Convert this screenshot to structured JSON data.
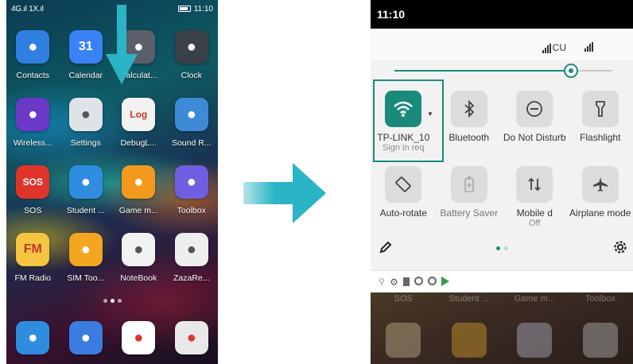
{
  "home": {
    "status": {
      "left": "4G.ıl 1X.ıl",
      "time": "11:10"
    },
    "rows": [
      [
        {
          "label": "Contacts",
          "icon": "contacts-icon",
          "color": "#2f7fe0"
        },
        {
          "label": "Calendar",
          "icon": "calendar-icon",
          "color": "#3b82f6",
          "glyph": "31"
        },
        {
          "label": "Calculat...",
          "icon": "calculator-icon",
          "color": "#5a5f6a"
        },
        {
          "label": "Clock",
          "icon": "clock-icon",
          "color": "#3a3f48"
        }
      ],
      [
        {
          "label": "Wireless...",
          "icon": "shield-icon",
          "color": "#6a39c8"
        },
        {
          "label": "Settings",
          "icon": "gear-icon",
          "color": "#dfe3e8"
        },
        {
          "label": "DebugL...",
          "icon": "log-icon",
          "color": "#f2f2f2",
          "glyph": "Log"
        },
        {
          "label": "Sound R...",
          "icon": "sound-recorder-icon",
          "color": "#3d8bd6"
        }
      ],
      [
        {
          "label": "SOS",
          "icon": "sos-icon",
          "color": "#e0342b",
          "glyph": "SOS"
        },
        {
          "label": "Student ...",
          "icon": "student-icon",
          "color": "#2f8de0"
        },
        {
          "label": "Game m...",
          "icon": "gamepad-icon",
          "color": "#f39a1e"
        },
        {
          "label": "Toolbox",
          "icon": "toolbox-icon",
          "color": "#6f5ee0"
        }
      ],
      [
        {
          "label": "FM Radio",
          "icon": "radio-icon",
          "color": "#f5c542",
          "glyph": "FM"
        },
        {
          "label": "SIM Too...",
          "icon": "sim-icon",
          "color": "#f4a623"
        },
        {
          "label": "NoteBook",
          "icon": "notebook-icon",
          "color": "#f2f2f2"
        },
        {
          "label": "ZazaRe...",
          "icon": "zaza-icon",
          "color": "#eeeeee"
        }
      ]
    ],
    "dock": [
      {
        "icon": "phone-icon",
        "color": "#2f8de0"
      },
      {
        "icon": "message-icon",
        "color": "#3b7ce0"
      },
      {
        "icon": "chrome-icon",
        "color": "#ffffff"
      },
      {
        "icon": "camera-icon",
        "color": "#e8e8e8"
      }
    ]
  },
  "quick_settings": {
    "time": "11:10",
    "carrier": "CU",
    "brightness_level": 0.81,
    "tiles": [
      [
        {
          "name": "wifi",
          "label": "TP-LINK_10",
          "sub": "Sign in req",
          "icon": "wifi-icon",
          "active": true
        },
        {
          "name": "bluetooth",
          "label": "Bluetooth",
          "icon": "bluetooth-icon",
          "active": false
        },
        {
          "name": "dnd",
          "label": "Do Not Disturb",
          "icon": "do-not-disturb-icon",
          "active": false
        },
        {
          "name": "flashlight",
          "label": "Flashlight",
          "icon": "flashlight-icon",
          "active": false
        }
      ],
      [
        {
          "name": "autorotate",
          "label": "Auto-rotate",
          "icon": "auto-rotate-icon",
          "active": false
        },
        {
          "name": "battery-saver",
          "label": "Battery Saver",
          "icon": "battery-saver-icon",
          "active": false,
          "dim": true
        },
        {
          "name": "mobile-data",
          "label": "Mobile d",
          "sub": "Off",
          "icon": "mobile-data-icon",
          "active": false
        },
        {
          "name": "airplane",
          "label": "Airplane mode",
          "icon": "airplane-icon",
          "active": false
        }
      ]
    ],
    "page_dots": 2,
    "ghost_labels": [
      "SOS",
      "Student ...",
      "Game m...",
      "Toolbox"
    ]
  },
  "colors": {
    "accent": "#1a8a7d",
    "arrow": "#2bb3c6"
  }
}
